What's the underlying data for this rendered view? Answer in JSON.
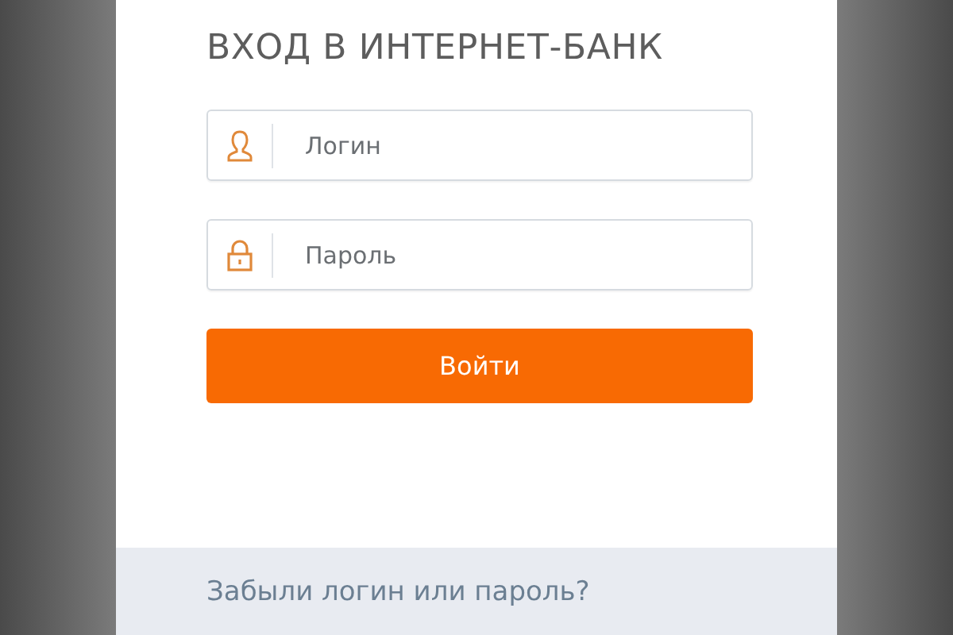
{
  "title": "ВХОД В ИНТЕРНЕТ-БАНК",
  "fields": [
    {
      "kind": "user",
      "placeholder": "Логин"
    },
    {
      "kind": "lock",
      "placeholder": "Пароль"
    }
  ],
  "submit_button": "Войти",
  "footer": {
    "link": "Забыли логин или пароль?"
  }
}
